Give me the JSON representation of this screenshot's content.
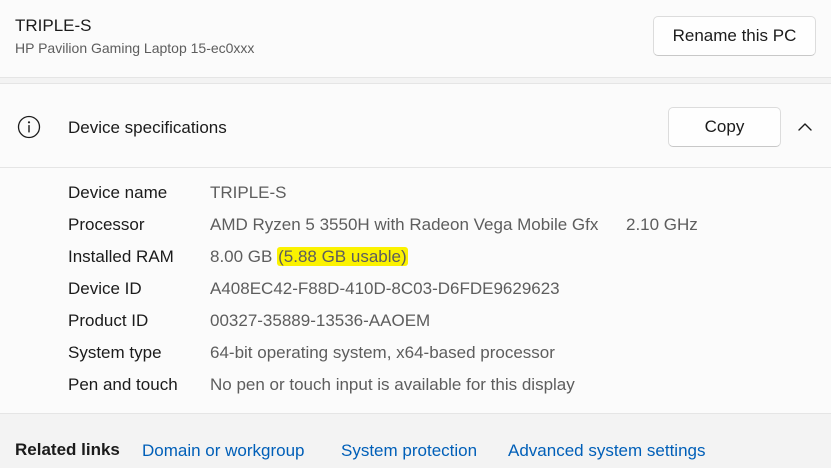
{
  "pc": {
    "name": "TRIPLE-S",
    "model": "HP Pavilion Gaming Laptop 15-ec0xxx",
    "rename_label": "Rename this PC"
  },
  "specs": {
    "title": "Device specifications",
    "copy_label": "Copy",
    "rows": [
      {
        "label": "Device name",
        "value": "TRIPLE-S"
      },
      {
        "label": "Processor",
        "value": "AMD Ryzen 5 3550H with Radeon Vega Mobile Gfx",
        "extra": "2.10 GHz"
      },
      {
        "label": "Installed RAM",
        "value": "8.00 GB",
        "highlight": "(5.88 GB usable)"
      },
      {
        "label": "Device ID",
        "value": "A408EC42-F88D-410D-8C03-D6FDE9629623"
      },
      {
        "label": "Product ID",
        "value": "00327-35889-13536-AAOEM"
      },
      {
        "label": "System type",
        "value": "64-bit operating system, x64-based processor"
      },
      {
        "label": "Pen and touch",
        "value": "No pen or touch input is available for this display"
      }
    ]
  },
  "related": {
    "title": "Related links",
    "links": [
      "Domain or workgroup",
      "System protection",
      "Advanced system settings"
    ]
  },
  "colors": {
    "accent": "#005fb8",
    "highlight": "#fbf200"
  },
  "icons": {
    "info": "info-icon",
    "collapse": "chevron-up-icon"
  }
}
